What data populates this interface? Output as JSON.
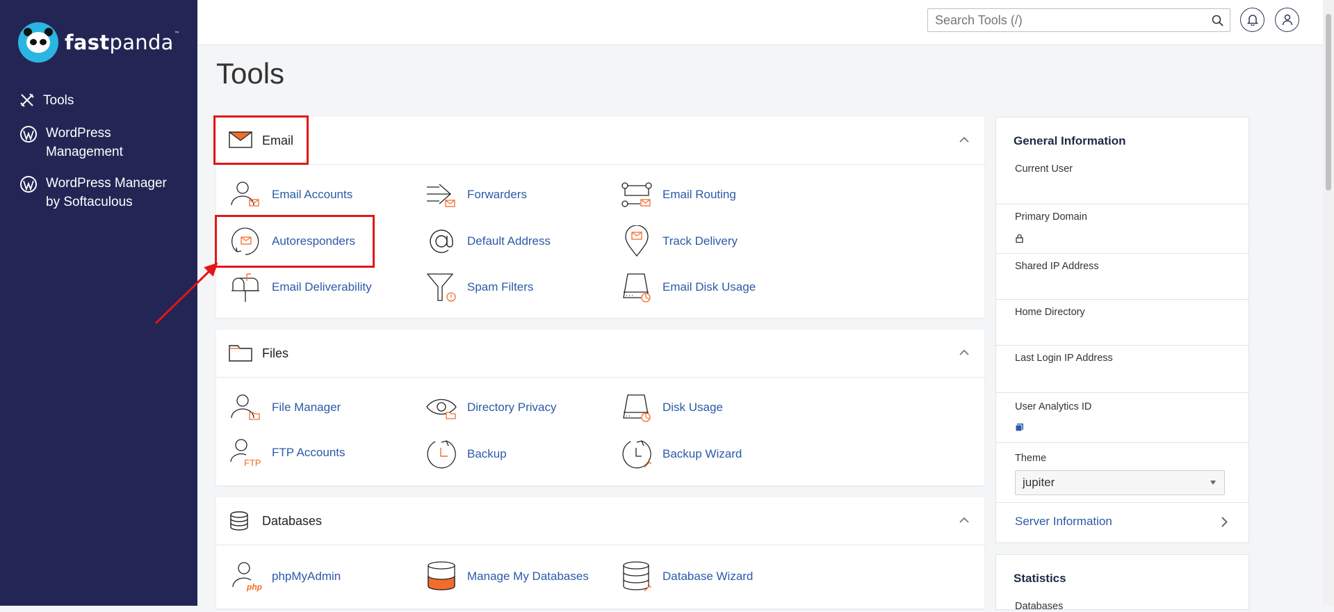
{
  "brand": {
    "name_bold": "fast",
    "name_regular": "panda",
    "tm": "™"
  },
  "sidebar": {
    "items": [
      {
        "label": "Tools",
        "icon": "tools-icon"
      },
      {
        "label_line1": "WordPress",
        "label_line2": "Management",
        "icon": "wordpress-icon"
      },
      {
        "label_line1": "WordPress Manager",
        "label_line2": "by Softaculous",
        "icon": "wordpress-icon"
      }
    ]
  },
  "topbar": {
    "search_placeholder": "Search Tools (/)"
  },
  "page": {
    "title": "Tools"
  },
  "sections": {
    "email": {
      "title": "Email",
      "tools": [
        "Email Accounts",
        "Forwarders",
        "Email Routing",
        "Autoresponders",
        "Default Address",
        "Track Delivery",
        "Email Deliverability",
        "Spam Filters",
        "Email Disk Usage"
      ]
    },
    "files": {
      "title": "Files",
      "tools": [
        "File Manager",
        "Directory Privacy",
        "Disk Usage",
        "FTP Accounts",
        "Backup",
        "Backup Wizard"
      ]
    },
    "databases": {
      "title": "Databases",
      "tools": [
        "phpMyAdmin",
        "Manage My Databases",
        "Database Wizard"
      ]
    }
  },
  "general_info": {
    "title": "General Information",
    "current_user": "Current User",
    "primary_domain": "Primary Domain",
    "shared_ip": "Shared IP Address",
    "home_directory": "Home Directory",
    "last_login_ip": "Last Login IP Address",
    "user_analytics_id": "User Analytics ID",
    "theme_label": "Theme",
    "theme_value": "jupiter",
    "server_info": "Server Information"
  },
  "statistics": {
    "title": "Statistics",
    "first_row": "Databases"
  },
  "colors": {
    "sidebar": "#232655",
    "link": "#2b5aa8",
    "accent": "#f26c2b",
    "highlight": "#e41515",
    "brand_blue": "#2ab6e0"
  }
}
